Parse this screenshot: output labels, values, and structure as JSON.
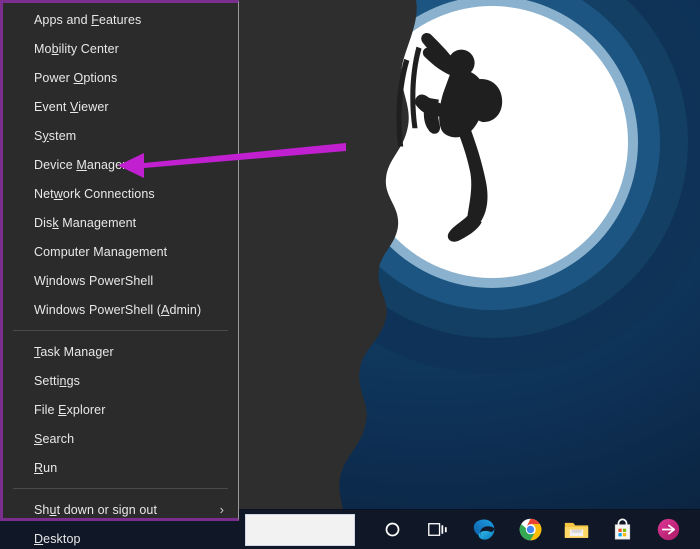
{
  "window": {
    "title": "Windows Power User Menu (Win+X)",
    "accent_border_color": "#7a2f8f",
    "menu_bg_color": "#2b2b2b",
    "menu_text_color": "#e8e8e8"
  },
  "power_menu": {
    "items": [
      {
        "label": "Apps and Features",
        "mnemonic": "F",
        "pre": "Apps and ",
        "post": "eatures",
        "has_submenu": false
      },
      {
        "label": "Mobility Center",
        "mnemonic": "b",
        "pre": "Mo",
        "post": "ility Center",
        "has_submenu": false
      },
      {
        "label": "Power Options",
        "mnemonic": "O",
        "pre": "Power ",
        "post": "ptions",
        "has_submenu": false
      },
      {
        "label": "Event Viewer",
        "mnemonic": "V",
        "pre": "Event ",
        "post": "iewer",
        "has_submenu": false
      },
      {
        "label": "System",
        "mnemonic": "y",
        "pre": "S",
        "post": "stem",
        "has_submenu": false
      },
      {
        "label": "Device Manager",
        "mnemonic": "M",
        "pre": "Device ",
        "post": "anager",
        "has_submenu": false
      },
      {
        "label": "Network Connections",
        "mnemonic": "w",
        "pre": "Net",
        "post": "ork Connections",
        "has_submenu": false
      },
      {
        "label": "Disk Management",
        "mnemonic": "k",
        "pre": "Dis",
        "post": " Management",
        "has_submenu": false
      },
      {
        "label": "Computer Management",
        "mnemonic": "g",
        "pre": "Computer Mana",
        "post": "ement",
        "has_submenu": false
      },
      {
        "label": "Windows PowerShell",
        "mnemonic": "i",
        "pre": "W",
        "post": "ndows PowerShell",
        "has_submenu": false
      },
      {
        "label": "Windows PowerShell (Admin)",
        "mnemonic": "A",
        "pre": "Windows PowerShell (",
        "post": "dmin)",
        "has_submenu": false
      },
      {
        "separator": true
      },
      {
        "label": "Task Manager",
        "mnemonic": "T",
        "pre": "",
        "post": "ask Manager",
        "has_submenu": false
      },
      {
        "label": "Settings",
        "mnemonic": "n",
        "pre": "Setti",
        "post": "gs",
        "has_submenu": false
      },
      {
        "label": "File Explorer",
        "mnemonic": "E",
        "pre": "File ",
        "post": "xplorer",
        "has_submenu": false
      },
      {
        "label": "Search",
        "mnemonic": "S",
        "pre": "",
        "post": "earch",
        "has_submenu": false
      },
      {
        "label": "Run",
        "mnemonic": "R",
        "pre": "",
        "post": "un",
        "has_submenu": false
      },
      {
        "separator": true
      },
      {
        "label": "Shut down or sign out",
        "mnemonic": "u",
        "pre": "Sh",
        "post": "t down or sign out",
        "has_submenu": true,
        "submenu_glyph": "›"
      },
      {
        "label": "Desktop",
        "mnemonic": "D",
        "pre": "",
        "post": "esktop",
        "has_submenu": false
      }
    ]
  },
  "annotation": {
    "type": "arrow",
    "color": "#c020d0",
    "direction": "left",
    "points_at": "Device Manager"
  },
  "wallpaper": {
    "description": "Rock climber silhouette on cliff against a full white moon with concentric blue rings",
    "colors": {
      "sky_outer": "#0b2240",
      "ring_mid": "#13436e",
      "ring_inner": "#2a6e9e",
      "ring_halo": "#bcd7e8",
      "moon": "#ffffff",
      "cliff": "#2e2e2e"
    }
  },
  "taskbar": {
    "background_color": "#101828",
    "search_box": {
      "value": "",
      "placeholder": ""
    },
    "icons": [
      {
        "name": "cortana-icon",
        "label": "Cortana"
      },
      {
        "name": "task-view-icon",
        "label": "Task View"
      },
      {
        "name": "microsoft-edge-icon",
        "label": "Microsoft Edge"
      },
      {
        "name": "google-chrome-icon",
        "label": "Google Chrome"
      },
      {
        "name": "file-explorer-icon",
        "label": "File Explorer"
      },
      {
        "name": "microsoft-store-icon",
        "label": "Microsoft Store"
      },
      {
        "name": "send-app-icon",
        "label": "Send"
      }
    ]
  }
}
